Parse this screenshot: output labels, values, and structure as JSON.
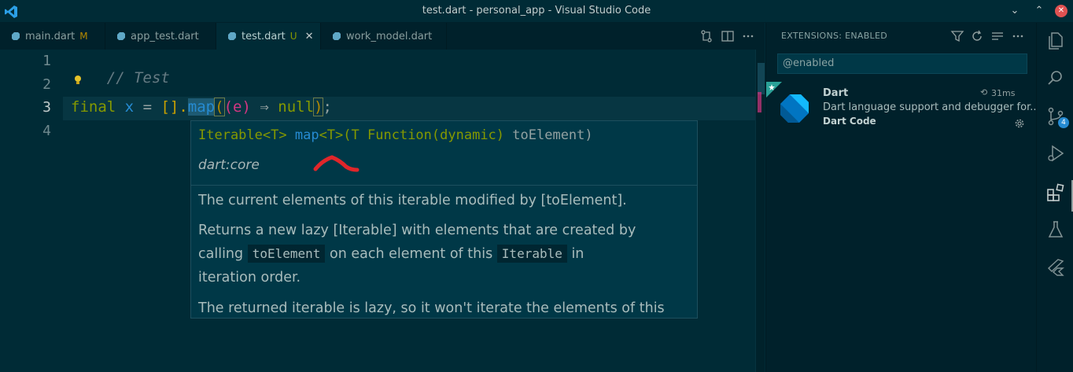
{
  "window": {
    "title": "test.dart - personal_app - Visual Studio Code"
  },
  "tabs": [
    {
      "label": "main.dart",
      "badge": "M"
    },
    {
      "label": "app_test.dart",
      "badge": ""
    },
    {
      "label": "test.dart",
      "badge": "U"
    },
    {
      "label": "work_model.dart",
      "badge": ""
    }
  ],
  "editor": {
    "line_numbers": [
      "1",
      "2",
      "3",
      "4"
    ],
    "line1": "// Test",
    "line3": {
      "kw_final": "final",
      "var_x": "x",
      "eq": "=",
      "list": "[].",
      "method": "map",
      "open": "(",
      "args": "(e)",
      "arrow": "⇒",
      "null": "null",
      "close": ")",
      "semi": ";"
    }
  },
  "hover": {
    "sig_part1": "Iterable<T>",
    "sig_part2": "map",
    "sig_part3": "<T>",
    "sig_part4": "(T",
    "sig_part5": "Function",
    "sig_part6": "(dynamic)",
    "sig_part7": "toElement)",
    "library": "dart:core",
    "p1": "The current elements of this iterable modified by [toElement].",
    "p2a": "Returns a new lazy [Iterable] with elements that are created by",
    "p2b": "calling",
    "p2code1": "toElement",
    "p2c": "on each element of this",
    "p2code2": "Iterable",
    "p2d": "in",
    "p2e": "iteration order.",
    "p3": "The returned iterable is lazy, so it won't iterate the elements of this"
  },
  "sidebar": {
    "title": "EXTENSIONS: ENABLED",
    "search_value": "@enabled",
    "extension": {
      "name": "Dart",
      "activation_time": "31ms",
      "description": "Dart language support and debugger for...",
      "publisher": "Dart Code"
    }
  },
  "activity_bar": {
    "source_control_badge": "4"
  },
  "colors": {
    "background": "#002b36",
    "keyword": "#859900",
    "function": "#268bd2",
    "type": "#b58900"
  }
}
